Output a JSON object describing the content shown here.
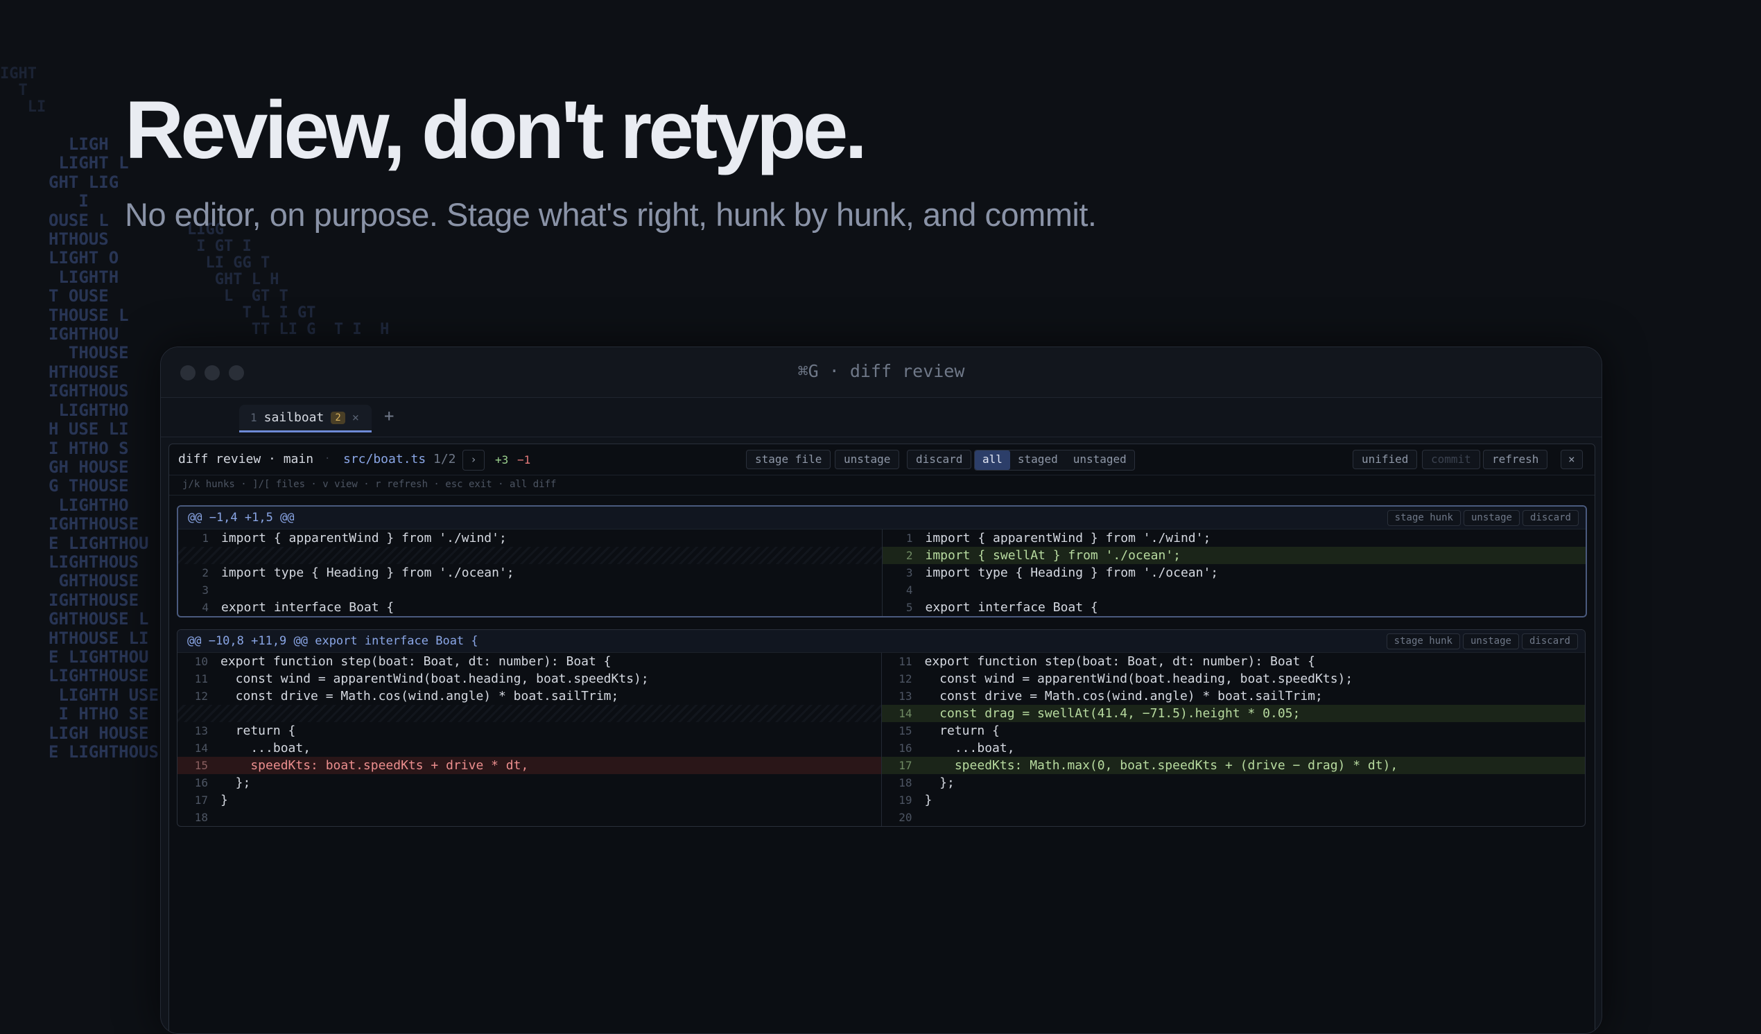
{
  "hero": {
    "title": "Review, don't retype.",
    "subtitle": "No editor, on purpose. Stage what's right, hunk by hunk, and commit."
  },
  "decor": {
    "ascii_column": "  LIGH\n LIGHT L\nGHT LIG\n   I\nOUSE L\nHTHOUS\nLIGHT O\n LIGHTH\nT OUSE\nTHOUSE L\nIGHTHOU\n  THOUSE\nHTHOUSE\nIGHTHOUS\n LIGHTHO\nH USE LI\nI HTHO S\nGH HOUSE\nG THOUSE\n LIGHTHO\nIGHTHOUSE\nE LIGHTHOU\nLIGHTHOUS\n GHTHOUSE\nIGHTHOUSE\nGHTHOUSE L\nHTHOUSE LI\nE LIGHTHOU\nLIGHTHOUSE\n LIGHTH USE\n I HTHO SE L\nLIGH HOUSE\nE LIGHTHOUS",
    "ascii_scatter": "LIGG\n I GT I\n  LI GG T\n   GHT L H\n    L  GT T\n      T L I GT\n       TT LI G  T I  H",
    "ascii_corner": "IGHT\n  T\n   LI"
  },
  "window": {
    "title": "⌘G · diff review",
    "tab": {
      "index": "1",
      "name": "sailboat",
      "badge": "2",
      "close": "×"
    },
    "new_tab": "+"
  },
  "toolbar": {
    "title": "diff review · main",
    "separator": "·",
    "file": "src/boat.ts",
    "position": "1/2",
    "next": "›",
    "additions": "+3",
    "deletions": "−1",
    "stage_file": "stage file",
    "unstage": "unstage",
    "discard": "discard",
    "filters": [
      "all",
      "staged",
      "unstaged"
    ],
    "active_filter": "all",
    "unified": "unified",
    "commit": "commit",
    "refresh": "refresh",
    "close": "×"
  },
  "hints": "j/k hunks · ]/[ files · v view · r refresh · esc exit · all diff",
  "hunk_actions": {
    "stage": "stage hunk",
    "unstage": "unstage",
    "discard": "discard"
  },
  "hunks": [
    {
      "header": "@@ −1,4 +1,5 @@",
      "left": [
        {
          "n": "1",
          "code": "import { apparentWind } from './wind';",
          "type": "ctx"
        },
        {
          "n": "",
          "code": "",
          "type": "filler"
        },
        {
          "n": "2",
          "code": "import type { Heading } from './ocean';",
          "type": "ctx"
        },
        {
          "n": "3",
          "code": "",
          "type": "ctx"
        },
        {
          "n": "4",
          "code": "export interface Boat {",
          "type": "ctx"
        }
      ],
      "right": [
        {
          "n": "1",
          "code": "import { apparentWind } from './wind';",
          "type": "ctx"
        },
        {
          "n": "2",
          "code": "import { swellAt } from './ocean';",
          "type": "add"
        },
        {
          "n": "3",
          "code": "import type { Heading } from './ocean';",
          "type": "ctx"
        },
        {
          "n": "4",
          "code": "",
          "type": "ctx"
        },
        {
          "n": "5",
          "code": "export interface Boat {",
          "type": "ctx"
        }
      ]
    },
    {
      "header": "@@ −10,8 +11,9 @@ export interface Boat {",
      "left": [
        {
          "n": "10",
          "code": "export function step(boat: Boat, dt: number): Boat {",
          "type": "ctx"
        },
        {
          "n": "11",
          "code": "  const wind = apparentWind(boat.heading, boat.speedKts);",
          "type": "ctx"
        },
        {
          "n": "12",
          "code": "  const drive = Math.cos(wind.angle) * boat.sailTrim;",
          "type": "ctx"
        },
        {
          "n": "",
          "code": "",
          "type": "filler"
        },
        {
          "n": "13",
          "code": "  return {",
          "type": "ctx"
        },
        {
          "n": "14",
          "code": "    ...boat,",
          "type": "ctx"
        },
        {
          "n": "15",
          "code": "    speedKts: boat.speedKts + drive * dt,",
          "type": "del"
        },
        {
          "n": "16",
          "code": "  };",
          "type": "ctx"
        },
        {
          "n": "17",
          "code": "}",
          "type": "ctx"
        },
        {
          "n": "18",
          "code": "",
          "type": "ctx"
        }
      ],
      "right": [
        {
          "n": "11",
          "code": "export function step(boat: Boat, dt: number): Boat {",
          "type": "ctx"
        },
        {
          "n": "12",
          "code": "  const wind = apparentWind(boat.heading, boat.speedKts);",
          "type": "ctx"
        },
        {
          "n": "13",
          "code": "  const drive = Math.cos(wind.angle) * boat.sailTrim;",
          "type": "ctx"
        },
        {
          "n": "14",
          "code": "  const drag = swellAt(41.4, −71.5).height * 0.05;",
          "type": "add"
        },
        {
          "n": "15",
          "code": "  return {",
          "type": "ctx"
        },
        {
          "n": "16",
          "code": "    ...boat,",
          "type": "ctx"
        },
        {
          "n": "17",
          "code": "    speedKts: Math.max(0, boat.speedKts + (drive − drag) * dt),",
          "type": "add"
        },
        {
          "n": "18",
          "code": "  };",
          "type": "ctx"
        },
        {
          "n": "19",
          "code": "}",
          "type": "ctx"
        },
        {
          "n": "20",
          "code": "",
          "type": "ctx"
        }
      ]
    }
  ]
}
